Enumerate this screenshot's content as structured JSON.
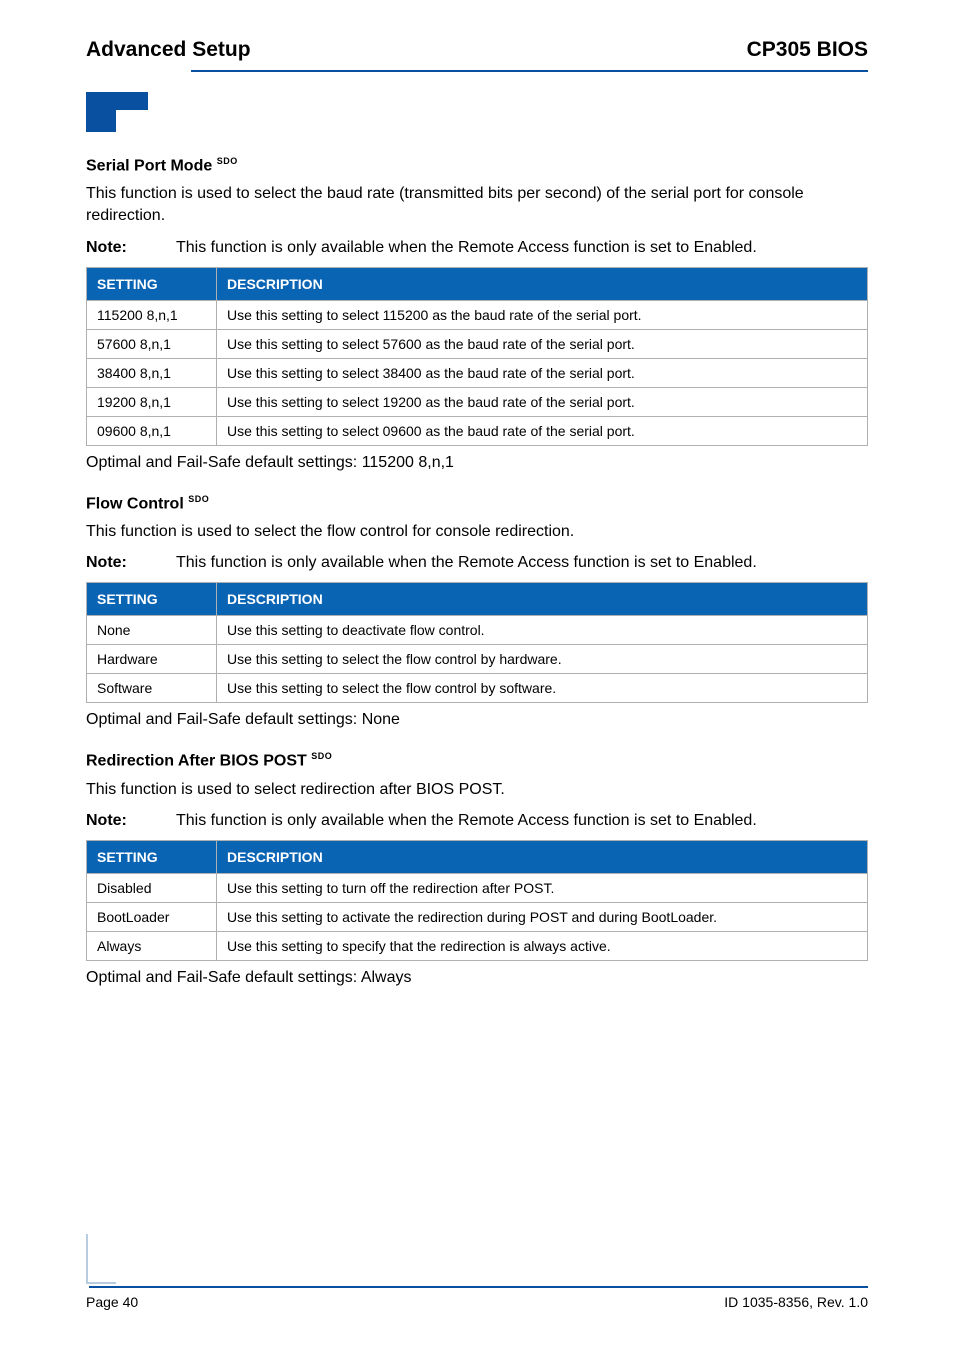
{
  "header": {
    "left": "Advanced Setup",
    "right": "CP305 BIOS"
  },
  "sections": [
    {
      "heading": "Serial Port Mode",
      "sup": "SDO",
      "intro": "This function is used to select the baud rate (transmitted bits per second) of the serial port for console redirection.",
      "note_label": "Note:",
      "note_text": "This function is only available when the Remote Access function is set to Enabled.",
      "table_headers": {
        "setting": "SETTING",
        "description": "DESCRIPTION"
      },
      "rows": [
        {
          "setting": "115200  8,n,1",
          "description": "Use this setting to select 115200 as the baud rate of the serial port."
        },
        {
          "setting": "57600  8,n,1",
          "description": "Use this setting to select 57600 as the baud rate of the serial port."
        },
        {
          "setting": "38400  8,n,1",
          "description": "Use this setting to select 38400 as the baud rate of the serial port."
        },
        {
          "setting": "19200  8,n,1",
          "description": "Use this setting to select 19200 as the baud rate of the serial port."
        },
        {
          "setting": "09600  8,n,1",
          "description": "Use this setting to select 09600 as the baud rate of the serial port."
        }
      ],
      "default": "Optimal and Fail-Safe default settings: 115200  8,n,1"
    },
    {
      "heading": "Flow Control",
      "sup": "SDO",
      "intro": "This function is used to select the flow control for console redirection.",
      "note_label": "Note:",
      "note_text": "This function is only available when the Remote Access function is set to Enabled.",
      "table_headers": {
        "setting": "SETTING",
        "description": "DESCRIPTION"
      },
      "rows": [
        {
          "setting": "None",
          "description": "Use this setting to deactivate flow control."
        },
        {
          "setting": "Hardware",
          "description": "Use this setting to select the flow control by hardware."
        },
        {
          "setting": "Software",
          "description": "Use this setting to select the flow control by software."
        }
      ],
      "default": "Optimal and Fail-Safe default settings: None"
    },
    {
      "heading": "Redirection After BIOS POST",
      "sup": "SDO",
      "intro": "This function is used to select redirection after BIOS POST.",
      "note_label": "Note:",
      "note_text": "This function is only available when the Remote Access function is set to Enabled.",
      "table_headers": {
        "setting": "SETTING",
        "description": "DESCRIPTION"
      },
      "rows": [
        {
          "setting": "Disabled",
          "description": "Use this setting to turn off the redirection after POST."
        },
        {
          "setting": "BootLoader",
          "description": "Use this setting to activate the redirection during POST and during BootLoader."
        },
        {
          "setting": "Always",
          "description": "Use this setting to specify that the redirection is always active."
        }
      ],
      "default": "Optimal and Fail-Safe default settings: Always"
    }
  ],
  "footer": {
    "left": "Page 40",
    "right": "ID 1035-8356, Rev. 1.0"
  }
}
